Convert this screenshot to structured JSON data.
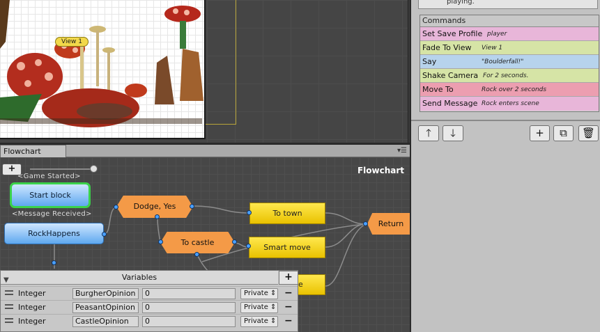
{
  "scene": {
    "view_label": "View 1"
  },
  "flowchart_tab": {
    "tab_label": "Flowchart",
    "title": "Flowchart",
    "add_label": "+",
    "events": {
      "game_started": "<Game Started>",
      "message_received": "<Message Received>"
    },
    "blocks": {
      "start_block": "Start block",
      "rock_happens": "RockHappens",
      "dodge_yes": "Dodge, Yes",
      "to_castle": "To castle",
      "to_town": "To town",
      "smart_move": "Smart move",
      "hidden_block": "ble",
      "return": "Return"
    }
  },
  "variables": {
    "title": "Variables",
    "add_label": "+",
    "rows": [
      {
        "type": "Integer",
        "name": "BurgherOpinion",
        "value": "0",
        "scope": "Private",
        "delete": "−"
      },
      {
        "type": "Integer",
        "name": "PeasantOpinion",
        "value": "0",
        "scope": "Private",
        "delete": "−"
      },
      {
        "type": "Integer",
        "name": "CastleOpinion",
        "value": "0",
        "scope": "Private",
        "delete": "−"
      }
    ]
  },
  "inspector": {
    "top_text": "playing.",
    "commands_title": "Commands",
    "commands": [
      {
        "name": "Set Save Profile",
        "summary": "player",
        "color": "#e8b6d9"
      },
      {
        "name": "Fade To View",
        "summary": "View 1",
        "color": "#d6e4a6"
      },
      {
        "name": "Say",
        "summary": "\"Boulderfall!\"",
        "color": "#b7d3ec"
      },
      {
        "name": "Shake Camera",
        "summary": "For 2 seconds.",
        "color": "#d6e4a6"
      },
      {
        "name": "Move To",
        "summary": "Rock over 2 seconds",
        "color": "#ec9eb0"
      },
      {
        "name": "Send Message",
        "summary": "Rock enters scene",
        "color": "#e8b6d9"
      }
    ],
    "toolbar": {
      "up": "🡑",
      "down": "🡓",
      "add": "+",
      "duplicate": "⧉",
      "delete": "🗑"
    }
  }
}
